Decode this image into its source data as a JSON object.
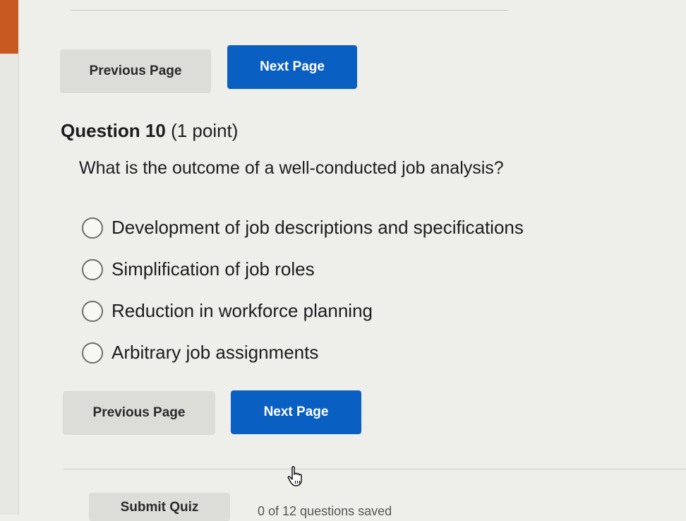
{
  "nav_top": {
    "previous_label": "Previous Page",
    "next_label": "Next Page"
  },
  "question": {
    "number_label": "Question 10",
    "points_label": "(1 point)",
    "text": "What is the outcome of a well-conducted job analysis?",
    "options": [
      {
        "label": "Development of job descriptions and specifications",
        "selected": false
      },
      {
        "label": "Simplification of job roles",
        "selected": false
      },
      {
        "label": "Reduction in workforce planning",
        "selected": false
      },
      {
        "label": "Arbitrary job assignments",
        "selected": false
      }
    ]
  },
  "nav_bottom": {
    "previous_label": "Previous Page",
    "next_label": "Next Page"
  },
  "footer": {
    "submit_label": "Submit Quiz",
    "progress_text": "0 of 12 questions saved"
  },
  "colors": {
    "primary_button": "#0a5fc2",
    "secondary_button": "#dcdcd9",
    "accent_edge": "#c85a1f"
  },
  "icons": {
    "cursor": "hand-pointer-icon"
  }
}
